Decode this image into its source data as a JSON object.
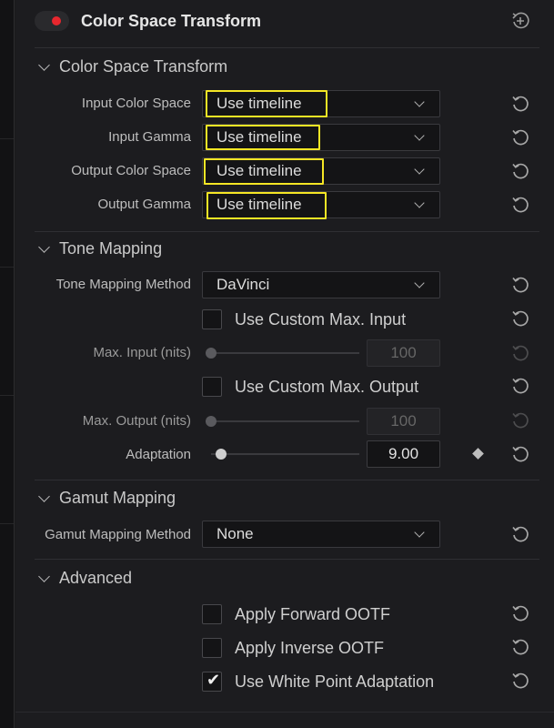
{
  "header": {
    "title": "Color Space Transform",
    "toggle_color": "#e8272e",
    "add_icon": "plus-circle-icon"
  },
  "sections": {
    "cst": {
      "title": "Color Space Transform",
      "input_color_space": {
        "label": "Input Color Space",
        "value": "Use timeline"
      },
      "input_gamma": {
        "label": "Input Gamma",
        "value": "Use timeline"
      },
      "output_color_space": {
        "label": "Output Color Space",
        "value": "Use timeline"
      },
      "output_gamma": {
        "label": "Output Gamma",
        "value": "Use timeline"
      }
    },
    "tone": {
      "title": "Tone Mapping",
      "method": {
        "label": "Tone Mapping Method",
        "value": "DaVinci"
      },
      "custom_max_input": {
        "label": "Use Custom Max. Input",
        "checked": false
      },
      "max_input": {
        "label": "Max. Input (nits)",
        "value": "100",
        "level": 0
      },
      "custom_max_output": {
        "label": "Use Custom Max. Output",
        "checked": false
      },
      "max_output": {
        "label": "Max. Output (nits)",
        "value": "100",
        "level": 0
      },
      "adaptation": {
        "label": "Adaptation",
        "value": "9.00",
        "level": 0.07
      }
    },
    "gamut": {
      "title": "Gamut Mapping",
      "method": {
        "label": "Gamut Mapping Method",
        "value": "None"
      }
    },
    "advanced": {
      "title": "Advanced",
      "forward_ootf": {
        "label": "Apply Forward OOTF",
        "checked": false
      },
      "inverse_ootf": {
        "label": "Apply Inverse OOTF",
        "checked": false
      },
      "white_point": {
        "label": "Use White Point Adaptation",
        "checked": true
      }
    }
  },
  "colors": {
    "highlight": "#f5e625",
    "panel_bg": "#1c1c1f"
  },
  "icons": {
    "reset": "reset-icon",
    "chevron": "chevron-down-icon",
    "keyframe": "keyframe-diamond-icon"
  }
}
